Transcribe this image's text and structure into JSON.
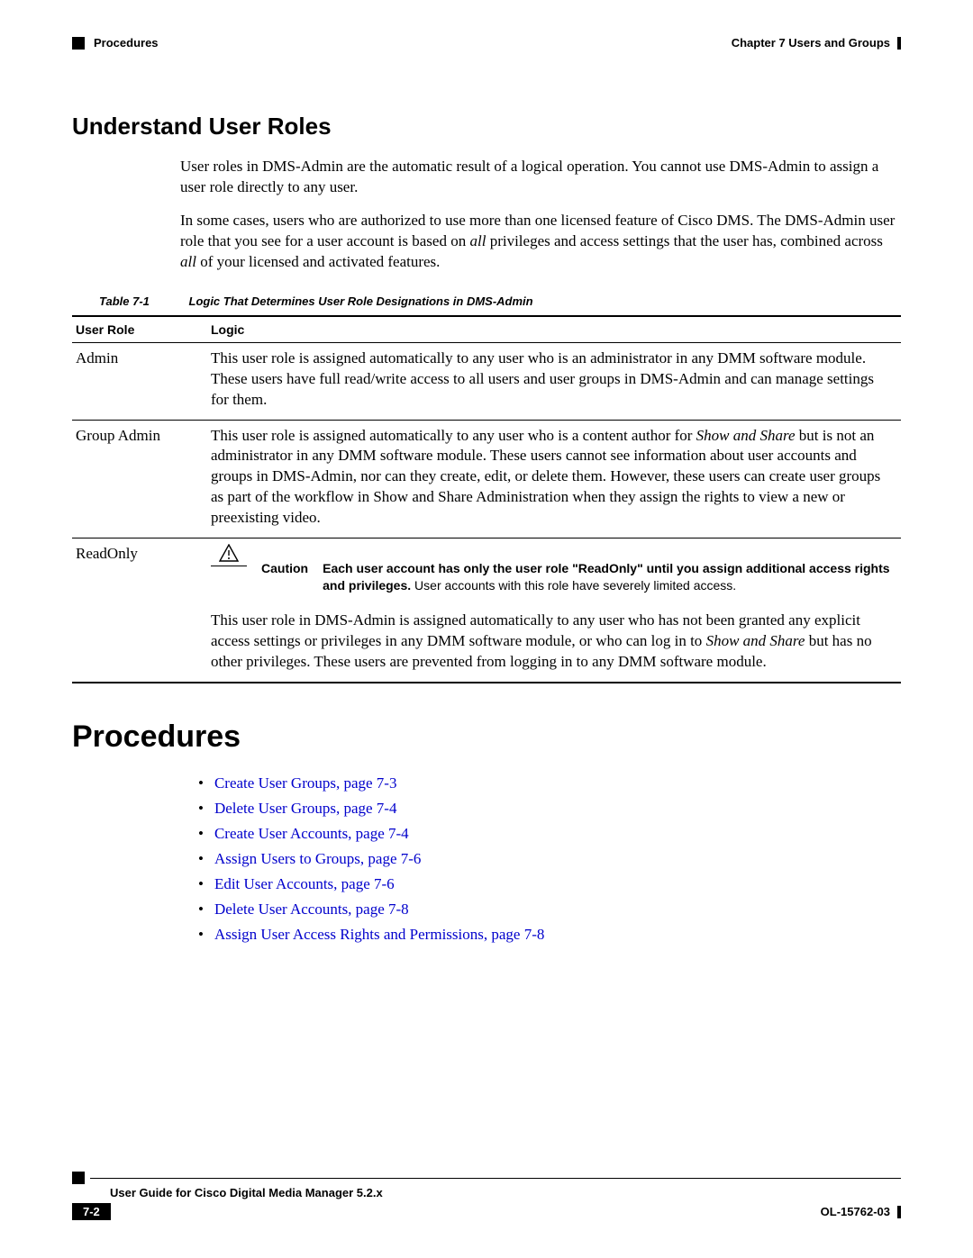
{
  "header": {
    "left_section": "Procedures",
    "right_chapter": "Chapter 7    Users and Groups"
  },
  "section1": {
    "title": "Understand User Roles",
    "para1_a": "User roles in DMS-Admin are the automatic result of a logical operation. You cannot use DMS-Admin to assign a user role directly to any user.",
    "para2_a": "In some cases, users who are authorized to use more than one licensed feature of Cisco DMS. The DMS-Admin user role that you see for a user account is based on ",
    "para2_em1": "all",
    "para2_b": " privileges and access settings that the user has, combined across ",
    "para2_em2": "all",
    "para2_c": " of your licensed and activated features."
  },
  "table": {
    "caption_num": "Table 7-1",
    "caption_title": "Logic That Determines User Role Designations in DMS-Admin",
    "col1": "User Role",
    "col2": "Logic",
    "rows": {
      "r1": {
        "role": "Admin",
        "logic": "This user role is assigned automatically to any user who is an administrator in any DMM software module. These users have full read/write access to all users and user groups in DMS-Admin and can manage settings for them."
      },
      "r2": {
        "role": "Group Admin",
        "logic_a": "This user role is assigned automatically to any user who is a content author for ",
        "logic_em1": "Show and Share",
        "logic_b": " but is not an administrator in any DMM software module. These users cannot see information about user accounts and groups in DMS-Admin, nor can they create, edit, or delete them. However, these users can create user groups as part of the workflow in Show and Share Administration when they assign the rights to view a new or preexisting video."
      },
      "r3": {
        "role": "ReadOnly",
        "caution_label": "Caution",
        "caution_bold": "Each user account has only the user role \"ReadOnly\" until you assign additional access rights and privileges.",
        "caution_rest": " User accounts with this role have severely limited access.",
        "logic_a": "This user role in DMS-Admin is assigned automatically to any user who has not been granted any explicit access settings or privileges in any DMM software module, or who can log in to ",
        "logic_em1": "Show and Share",
        "logic_b": " but has no other privileges. These users are prevented from logging in to any DMM software module."
      }
    }
  },
  "section2": {
    "title": "Procedures",
    "links": {
      "l1": "Create User Groups, page 7-3",
      "l2": "Delete User Groups, page 7-4",
      "l3": "Create User Accounts, page 7-4",
      "l4": "Assign Users to Groups, page 7-6",
      "l5": "Edit User Accounts, page 7-6",
      "l6": "Delete User Accounts, page 7-8",
      "l7": "Assign User Access Rights and Permissions, page 7-8"
    }
  },
  "footer": {
    "guide_title": "User Guide for Cisco Digital Media Manager 5.2.x",
    "page_num": "7-2",
    "doc_id": "OL-15762-03"
  }
}
